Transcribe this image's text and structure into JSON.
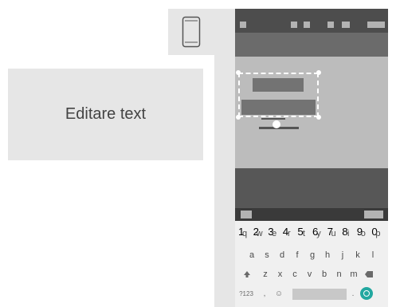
{
  "label": "Editare text",
  "icons": {
    "device": "smartphone-icon"
  },
  "keyboard": {
    "row1": [
      {
        "k": "q",
        "n": "1"
      },
      {
        "k": "w",
        "n": "2"
      },
      {
        "k": "e",
        "n": "3"
      },
      {
        "k": "r",
        "n": "4"
      },
      {
        "k": "t",
        "n": "5"
      },
      {
        "k": "y",
        "n": "6"
      },
      {
        "k": "u",
        "n": "7"
      },
      {
        "k": "i",
        "n": "8"
      },
      {
        "k": "o",
        "n": "9"
      },
      {
        "k": "p",
        "n": "0"
      }
    ],
    "row2": [
      "a",
      "s",
      "d",
      "f",
      "g",
      "h",
      "j",
      "k",
      "l"
    ],
    "row3": [
      "z",
      "x",
      "c",
      "v",
      "b",
      "n",
      "m"
    ],
    "bottom": {
      "sym": "?123",
      "comma": ",",
      "emoji": "☺",
      "period": "."
    }
  },
  "colors": {
    "accent": "#22a8a0",
    "status_bar": "#4d4d4d",
    "content": "#bcbcbc",
    "label_bg": "#e6e6e6"
  }
}
